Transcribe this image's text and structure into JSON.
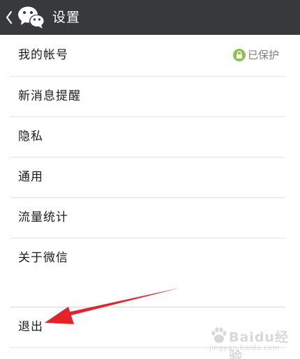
{
  "header": {
    "title": "设置"
  },
  "menu": {
    "items": [
      {
        "label": "我的帐号",
        "status": "已保护"
      },
      {
        "label": "新消息提醒"
      },
      {
        "label": "隐私"
      },
      {
        "label": "通用"
      },
      {
        "label": "流量统计"
      },
      {
        "label": "关于微信"
      }
    ],
    "logout_label": "退出"
  },
  "icons": {
    "back": "chevron-left-icon",
    "app_logo": "wechat-logo-icon",
    "protected": "lock-icon"
  },
  "colors": {
    "titlebar": "#37393b",
    "protected_green": "#8bc34a",
    "annotation_arrow": "#e8202a"
  },
  "watermark": {
    "main": "Baidu经验",
    "sub": "jingyan.baidu.com"
  }
}
